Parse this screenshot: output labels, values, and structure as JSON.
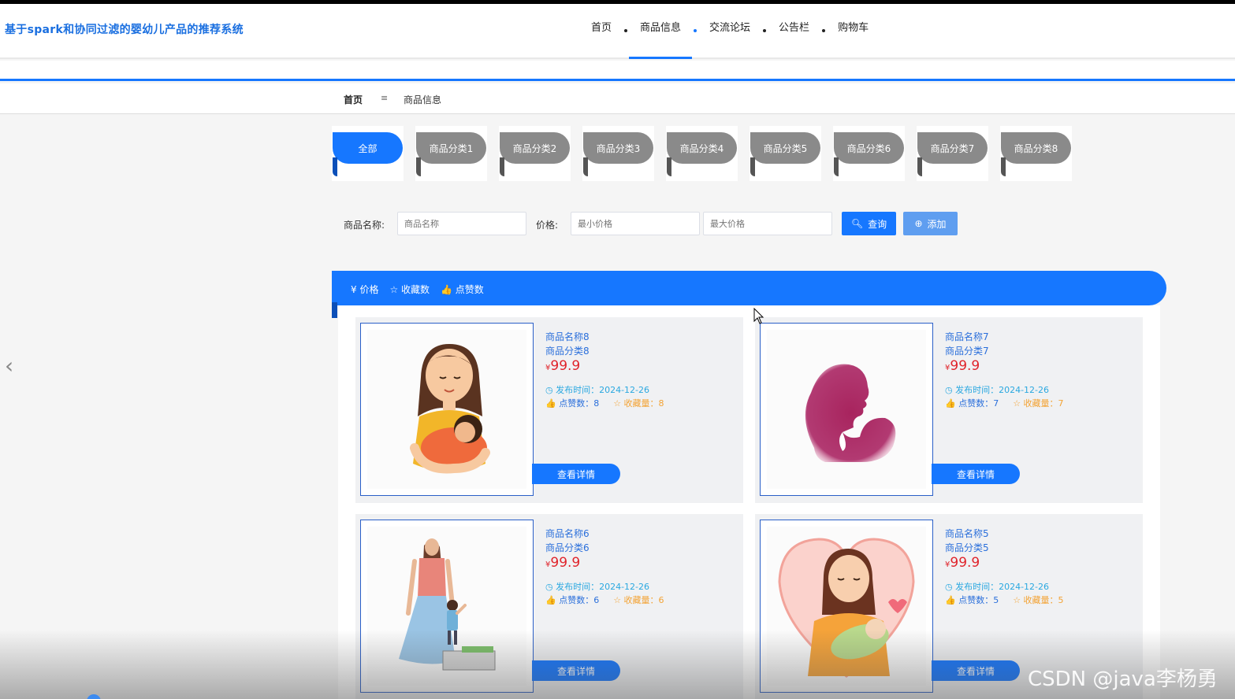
{
  "header": {
    "site_title": "基于spark和协同过滤的婴幼儿产品的推荐系统",
    "nav": [
      "首页",
      "商品信息",
      "交流论坛",
      "公告栏",
      "购物车"
    ],
    "active_nav": "商品信息"
  },
  "breadcrumb": {
    "home": "首页",
    "separator": "≡",
    "current": "商品信息"
  },
  "categories": [
    "全部",
    "商品分类1",
    "商品分类2",
    "商品分类3",
    "商品分类4",
    "商品分类5",
    "商品分类6",
    "商品分类7",
    "商品分类8"
  ],
  "active_category": "全部",
  "search": {
    "name_label": "商品名称:",
    "name_placeholder": "商品名称",
    "price_label": "价格:",
    "min_placeholder": "最小价格",
    "max_placeholder": "最大价格",
    "query_label": "查询",
    "add_label": "添加"
  },
  "sort": {
    "price": "¥ 价格",
    "favorites": "☆ 收藏数",
    "likes": "👍 点赞数"
  },
  "products": [
    {
      "name": "商品名称8",
      "category": "商品分类8",
      "currency": "¥",
      "price": "99.9",
      "time": "◷ 发布时间：2024-12-26",
      "likes": "👍 点赞数：8",
      "favs": "☆ 收藏量：8",
      "detail": "查看详情"
    },
    {
      "name": "商品名称7",
      "category": "商品分类7",
      "currency": "¥",
      "price": "99.9",
      "time": "◷ 发布时间：2024-12-26",
      "likes": "👍 点赞数：7",
      "favs": "☆ 收藏量：7",
      "detail": "查看详情"
    },
    {
      "name": "商品名称6",
      "category": "商品分类6",
      "currency": "¥",
      "price": "99.9",
      "time": "◷ 发布时间：2024-12-26",
      "likes": "👍 点赞数：6",
      "favs": "☆ 收藏量：6",
      "detail": "查看详情"
    },
    {
      "name": "商品名称5",
      "category": "商品分类5",
      "currency": "¥",
      "price": "99.9",
      "time": "◷ 发布时间：2024-12-26",
      "likes": "👍 点赞数：5",
      "favs": "☆ 收藏量：5",
      "detail": "查看详情"
    }
  ],
  "watermark": "CSDN @java李杨勇",
  "colors": {
    "primary": "#1677ff",
    "price": "#e0242b",
    "favorite": "#f3a334"
  }
}
